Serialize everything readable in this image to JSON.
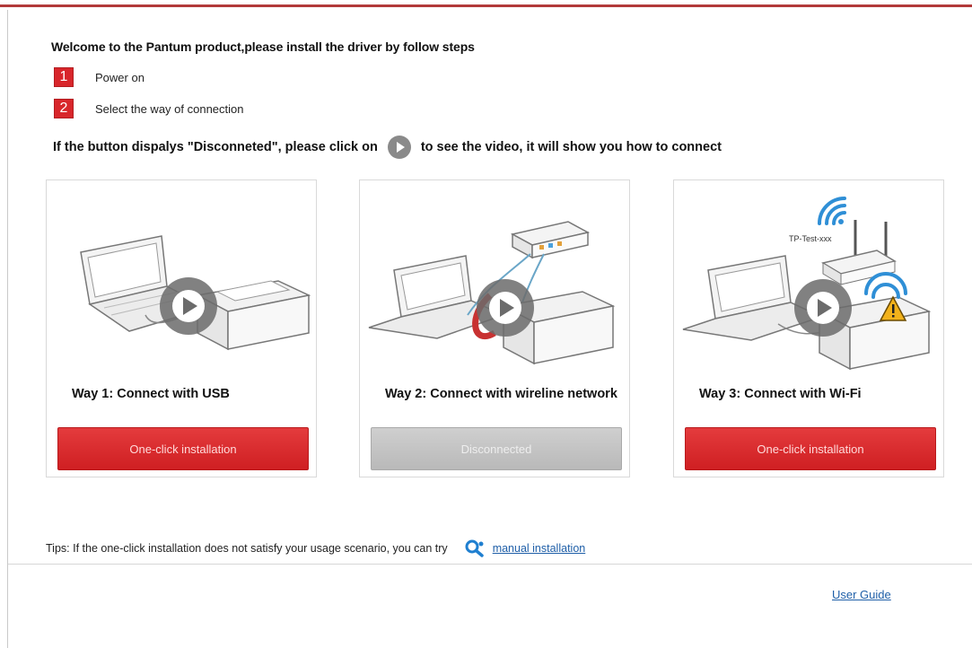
{
  "header": {
    "welcome": "Welcome to the Pantum product,please install the driver by follow steps"
  },
  "steps": [
    {
      "number": "1",
      "text": "Power on"
    },
    {
      "number": "2",
      "text": "Select the way of connection"
    }
  ],
  "instruction": {
    "before": "If the button dispalys \"Disconneted\", please click on",
    "after": "to see the video, it will show you how to connect"
  },
  "cards": [
    {
      "title": "Way 1: Connect with USB",
      "button_label": "One-click installation",
      "button_state": "enabled"
    },
    {
      "title": "Way 2: Connect with wireline network",
      "button_label": "Disconnected",
      "button_state": "disabled"
    },
    {
      "title": "Way 3: Connect with Wi-Fi",
      "button_label": "One-click installation",
      "button_state": "enabled",
      "network_name": "TP-Test-xxx"
    }
  ],
  "tips": {
    "text": "Tips: If the one-click installation does not satisfy your usage scenario, you can try",
    "link": "manual installation"
  },
  "footer": {
    "user_guide": "User Guide"
  },
  "colors": {
    "accent_red": "#d8262b",
    "disabled_gray": "#bdbdbd",
    "link_blue": "#1f5fa8",
    "wifi_blue": "#2f8fd6",
    "warning_yellow": "#f2b21b"
  }
}
